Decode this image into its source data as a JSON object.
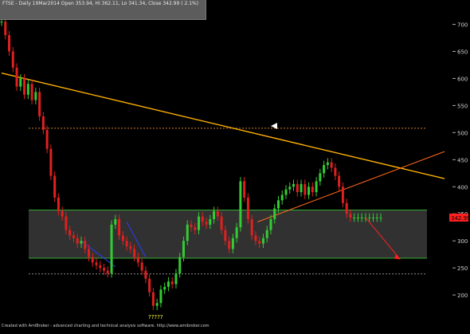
{
  "header": {
    "caption": "FTSE - Daily 19Mar2014 Open 353.94, Hi 362.11, Lo 341.34, Close 342.99 ( 2.1%)"
  },
  "footer": {
    "caption": "Created with AmiBroker - advanced charting and technical analysis software. http://www.amibroker.com"
  },
  "markers": {
    "question_marks": "?????"
  },
  "colors": {
    "background": "#000000",
    "up_candle": "#33cc33",
    "down_candle": "#e02020",
    "resistance_line": "#ffb000",
    "support_trend_line": "#ff6a1a",
    "range_box": "#3a3a3a",
    "range_border": "#33aa33",
    "blue_channel": "#2a3cff",
    "price_badge": "#ff2020"
  },
  "chart_data": {
    "type": "line",
    "title": "",
    "xlabel": "",
    "ylabel": "",
    "ylim": [
      150,
      745
    ],
    "yticks": [
      200,
      250,
      300,
      350,
      400,
      450,
      500,
      550,
      600,
      650,
      700
    ],
    "last_price_label": "342.99",
    "grid": false,
    "series": [
      {
        "style": "candles",
        "x": [
          0,
          4,
          8,
          12,
          16,
          20,
          24,
          28,
          32,
          36,
          40,
          44,
          48,
          52,
          56,
          60,
          64,
          68,
          72,
          76,
          80,
          84,
          88,
          92,
          96,
          100,
          104,
          108,
          112,
          116,
          120,
          124,
          128,
          132,
          136,
          140,
          144,
          148,
          152,
          156,
          160,
          164,
          168,
          172,
          176,
          180,
          184,
          188,
          192,
          196,
          200,
          204,
          208,
          212,
          216,
          220,
          224,
          228,
          232,
          236,
          240,
          244,
          248,
          252,
          256,
          260,
          264,
          268,
          272,
          276,
          280,
          284,
          288,
          292,
          296,
          300,
          304,
          308,
          312,
          316,
          320,
          324,
          328,
          332,
          336,
          340,
          344,
          348,
          352,
          356,
          360,
          364,
          368,
          372,
          376,
          380,
          384,
          388,
          392,
          396,
          400
        ],
        "values": [
          705,
          680,
          650,
          620,
          585,
          600,
          570,
          590,
          560,
          575,
          530,
          505,
          470,
          420,
          380,
          355,
          345,
          320,
          310,
          305,
          295,
          300,
          285,
          270,
          260,
          255,
          250,
          245,
          240,
          330,
          340,
          310,
          300,
          290,
          285,
          270,
          260,
          245,
          230,
          205,
          180,
          185,
          210,
          215,
          225,
          220,
          240,
          270,
          300,
          330,
          325,
          320,
          345,
          335,
          330,
          340,
          355,
          345,
          320,
          300,
          285,
          305,
          325,
          410,
          380,
          340,
          310,
          300,
          295,
          305,
          320,
          340,
          360,
          375,
          385,
          395,
          400,
          405,
          390,
          405,
          385,
          400,
          390,
          410,
          425,
          440,
          445,
          435,
          420,
          400,
          370,
          350,
          343,
          343,
          343,
          343,
          343,
          343,
          343,
          343,
          343
        ]
      }
    ],
    "levels": [
      {
        "value": 508,
        "style": "dotted"
      },
      {
        "value": 357,
        "style": "solid"
      },
      {
        "value": 268,
        "style": "solid"
      },
      {
        "value": 239,
        "style": "dotted"
      }
    ],
    "range_box": [
      268,
      357
    ],
    "trend_lines": [
      {
        "from": [
          0,
          610
        ],
        "to": [
          400,
          420
        ]
      },
      {
        "from": [
          270,
          335
        ],
        "to": [
          400,
          445
        ]
      }
    ]
  }
}
